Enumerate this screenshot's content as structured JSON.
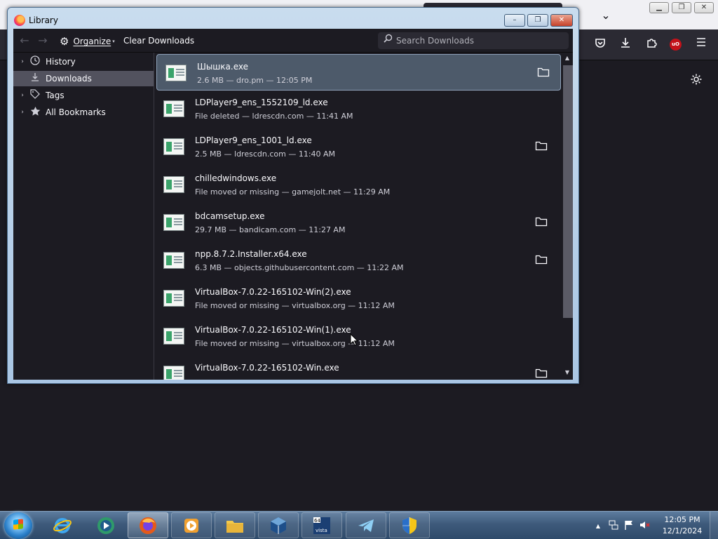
{
  "background_browser": {
    "toolbar_icons": [
      "pocket-icon",
      "download-icon",
      "extensions-icon",
      "ublock-icon",
      "menu-icon"
    ],
    "ublock_badge": "uO",
    "gear_icon": "gear-icon"
  },
  "library": {
    "title": "Library",
    "controls": {
      "minimize": "–",
      "restore": "❐",
      "close": "✕"
    },
    "toolbar": {
      "back": "←",
      "forward": "→",
      "organize_label": "Organize",
      "organize_arrow": "▾",
      "clear_downloads_label": "Clear Downloads",
      "search_placeholder": "Search Downloads"
    },
    "sidebar": {
      "items": [
        {
          "label": "History",
          "twisty": "›",
          "icon": "clock-icon",
          "selected": false
        },
        {
          "label": "Downloads",
          "twisty": "",
          "icon": "download-icon",
          "selected": true
        },
        {
          "label": "Tags",
          "twisty": "›",
          "icon": "tag-icon",
          "selected": false
        },
        {
          "label": "All Bookmarks",
          "twisty": "›",
          "icon": "star-icon",
          "selected": false
        }
      ]
    },
    "downloads": [
      {
        "name": "Шышка.exe",
        "status": "2.6 MB — dro.pm — 12:05 PM",
        "folder": true,
        "selected": true
      },
      {
        "name": "LDPlayer9_ens_1552109_ld.exe",
        "status": "File deleted — ldrescdn.com — 11:41 AM",
        "folder": false,
        "selected": false
      },
      {
        "name": "LDPlayer9_ens_1001_ld.exe",
        "status": "2.5 MB — ldrescdn.com — 11:40 AM",
        "folder": true,
        "selected": false
      },
      {
        "name": "chilledwindows.exe",
        "status": "File moved or missing — gamejolt.net — 11:29 AM",
        "folder": false,
        "selected": false
      },
      {
        "name": "bdcamsetup.exe",
        "status": "29.7 MB — bandicam.com — 11:27 AM",
        "folder": true,
        "selected": false
      },
      {
        "name": "npp.8.7.2.Installer.x64.exe",
        "status": "6.3 MB — objects.githubusercontent.com — 11:22 AM",
        "folder": true,
        "selected": false
      },
      {
        "name": "VirtualBox-7.0.22-165102-Win(2).exe",
        "status": "File moved or missing — virtualbox.org — 11:12 AM",
        "folder": false,
        "selected": false
      },
      {
        "name": "VirtualBox-7.0.22-165102-Win(1).exe",
        "status": "File moved or missing — virtualbox.org — 11:12 AM",
        "folder": false,
        "selected": false
      },
      {
        "name": "VirtualBox-7.0.22-165102-Win.exe",
        "status": "",
        "folder": true,
        "selected": false
      }
    ]
  },
  "taskbar": {
    "start_icon": "windows-start-icon",
    "apps": [
      {
        "name": "internet-explorer",
        "active": false
      },
      {
        "name": "media-center",
        "active": false
      },
      {
        "name": "firefox",
        "active": true
      },
      {
        "name": "media-player",
        "active": false
      },
      {
        "name": "file-explorer",
        "active": false
      },
      {
        "name": "virtualbox",
        "active": false
      },
      {
        "name": "vista-64",
        "active": false
      },
      {
        "name": "telegram",
        "active": false
      },
      {
        "name": "security-shield",
        "active": false
      }
    ],
    "tray": {
      "expand": "▲",
      "icons": [
        "network-icon",
        "action-center-flag-icon",
        "volume-muted-icon"
      ]
    },
    "clock": {
      "time": "12:05 PM",
      "date": "12/1/2024"
    }
  }
}
